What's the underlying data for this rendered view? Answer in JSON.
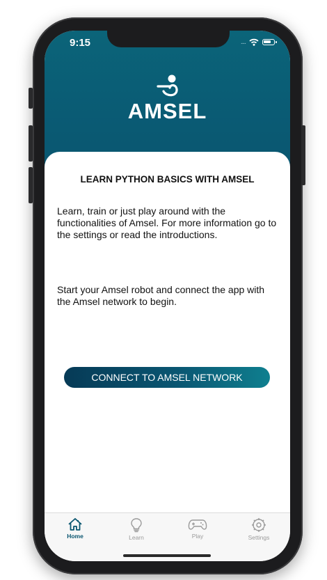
{
  "status_bar": {
    "time": "9:15",
    "signal": "....",
    "icons": [
      "wifi-icon",
      "battery-icon"
    ]
  },
  "header": {
    "brand": "AMSEL",
    "logo_icon": "amsel-logo-icon",
    "background_color": "#0a5b74"
  },
  "main": {
    "title": "LEARN PYTHON BASICS WITH AMSEL",
    "paragraph_1": "Learn, train or just play around with the functionalities of Amsel. For more information go to the settings or read the introductions.",
    "paragraph_2": "Start your Amsel robot and connect the app with the Amsel network to begin.",
    "connect_button": "CONNECT TO AMSEL NETWORK",
    "button_gradient": [
      "#063a56",
      "#0f7f8f"
    ]
  },
  "tabbar": {
    "items": [
      {
        "label": "Home",
        "icon": "home-icon",
        "active": true
      },
      {
        "label": "Learn",
        "icon": "lightbulb-icon",
        "active": false
      },
      {
        "label": "Play",
        "icon": "gamepad-icon",
        "active": false
      },
      {
        "label": "Settings",
        "icon": "gear-icon",
        "active": false
      }
    ],
    "active_color": "#0a5670",
    "inactive_color": "#9a9a9a"
  }
}
